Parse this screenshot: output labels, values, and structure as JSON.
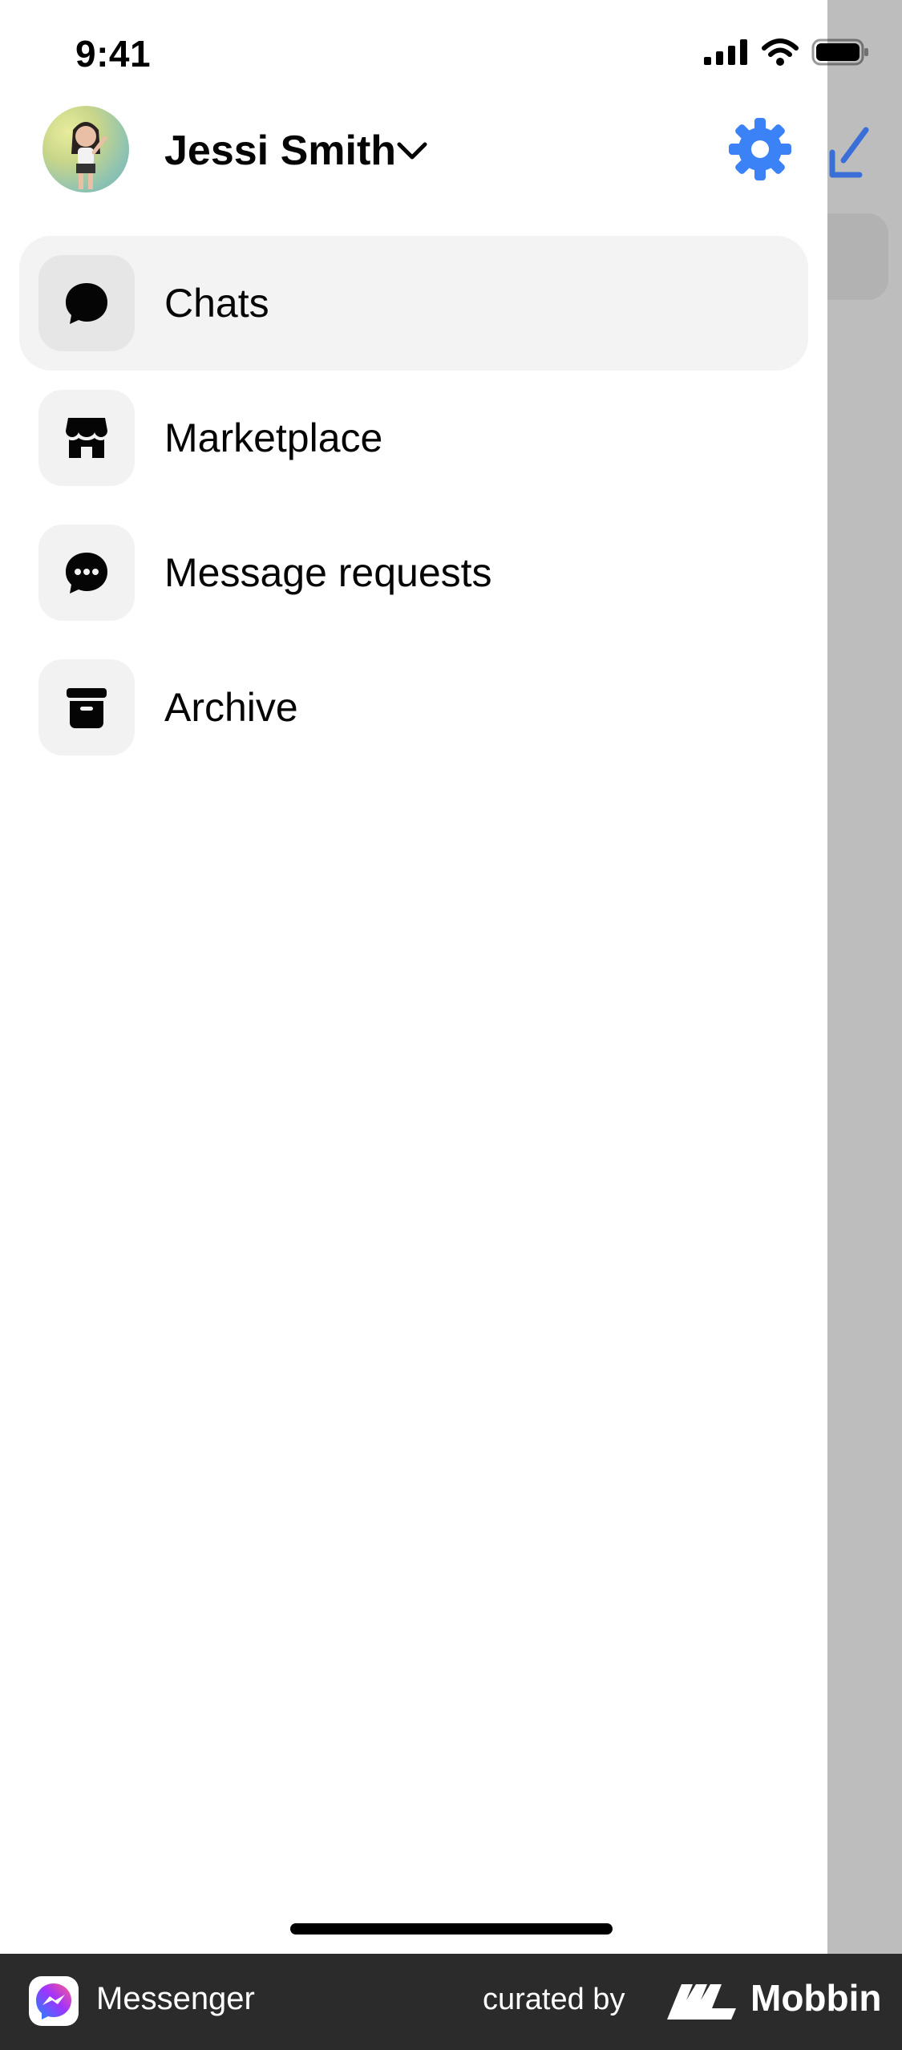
{
  "status_bar": {
    "time": "9:41",
    "icons": [
      "cellular-signal-icon",
      "wifi-icon",
      "battery-icon"
    ]
  },
  "header": {
    "profile_name": "Jessi Smith",
    "chevron_icon": "chevron-down-icon",
    "settings_icon": "gear-icon"
  },
  "menu": {
    "items": [
      {
        "label": "Chats",
        "icon": "chat-bubble-icon",
        "active": true
      },
      {
        "label": "Marketplace",
        "icon": "storefront-icon",
        "active": false
      },
      {
        "label": "Message requests",
        "icon": "message-requests-icon",
        "active": false
      },
      {
        "label": "Archive",
        "icon": "archive-box-icon",
        "active": false
      }
    ]
  },
  "colors": {
    "accent": "#3b82f6",
    "active_row": "#f3f3f3",
    "icon_tile": "#f2f2f2",
    "underlay": "#bdbdbd",
    "footer": "#2b2b2b"
  },
  "footer": {
    "app_name": "Messenger",
    "curated_by": "curated by",
    "brand": "Mobbin"
  }
}
